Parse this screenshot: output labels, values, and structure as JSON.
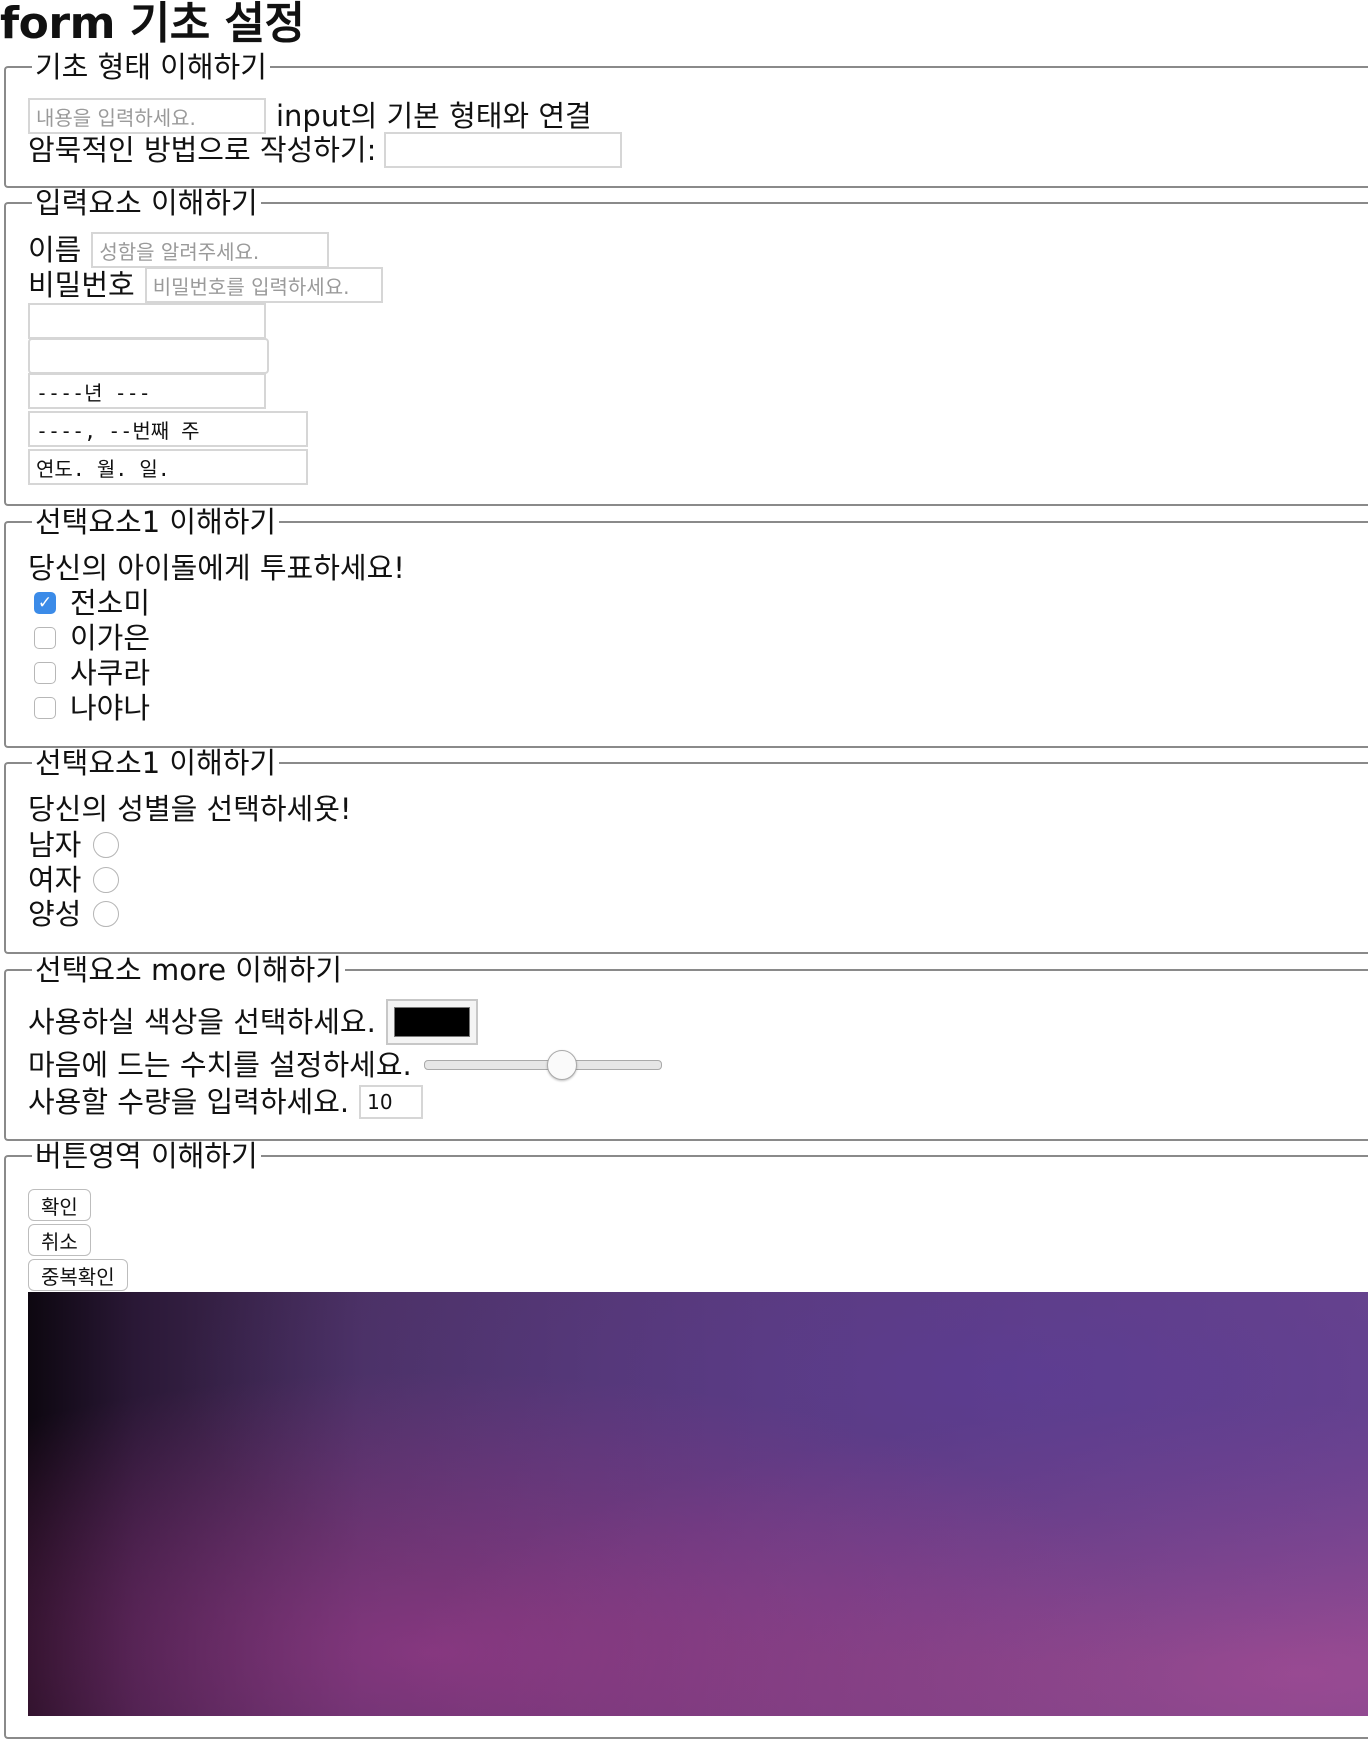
{
  "page_title": "form 기초 설정",
  "basic": {
    "legend": "기초 형태 이해하기",
    "placeholder": "내용을 입력하세요.",
    "link_label": "input의 기본 형태와 연결",
    "implicit_label": "암묵적인 방법으로 작성하기:"
  },
  "inputs": {
    "legend": "입력요소 이해하기",
    "name_label": "이름",
    "name_placeholder": "성함을 알려주세요.",
    "password_label": "비밀번호",
    "password_placeholder": "비밀번호를 입력하세요.",
    "month_value": "----년 ---",
    "week_value": "----, --번째 주",
    "date_value": "연도. 월. 일."
  },
  "checkbox_section": {
    "legend": "선택요소1 이해하기",
    "question": "당신의 아이돌에게 투표하세요!",
    "options": [
      {
        "label": "전소미",
        "checked": true
      },
      {
        "label": "이가은",
        "checked": false
      },
      {
        "label": "사쿠라",
        "checked": false
      },
      {
        "label": "나야나",
        "checked": false
      }
    ]
  },
  "radio_section": {
    "legend": "선택요소1 이해하기",
    "question": "당신의 성별을 선택하세욧!",
    "options": [
      {
        "label": "남자"
      },
      {
        "label": "여자"
      },
      {
        "label": "양성"
      }
    ]
  },
  "more_section": {
    "legend": "선택요소 more 이해하기",
    "color_label": "사용하실 색상을 선택하세요.",
    "color_value": "#000000",
    "range_label": "마음에 드는 수치를 설정하세요.",
    "range_value_fraction": 0.59,
    "number_label": "사용할 수량을 입력하세요.",
    "number_value": "10"
  },
  "button_section": {
    "legend": "버튼영역 이해하기",
    "buttons": [
      "확인",
      "취소",
      "중복확인"
    ]
  }
}
